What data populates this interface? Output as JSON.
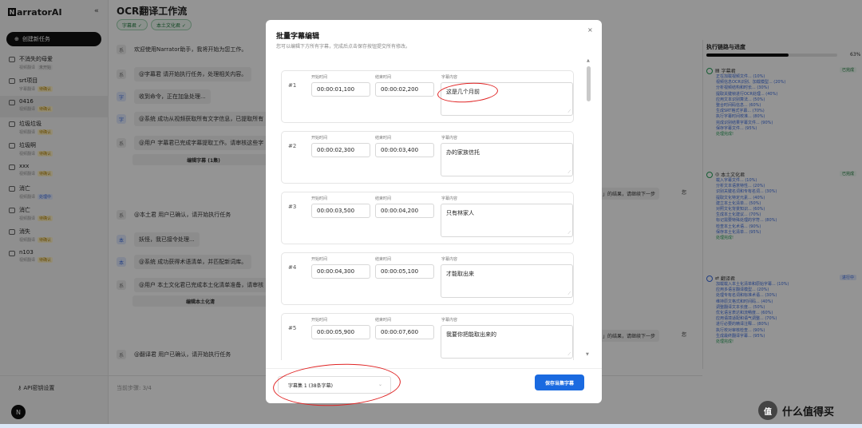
{
  "sidebar": {
    "brand": "NarratorAI",
    "brand_letter": "N",
    "brand_rest": "arratorAI",
    "collapse_glyph": "«",
    "new_task": "创建新任务",
    "tasks": [
      {
        "name": "不消失的母爱",
        "sub": "视频翻译",
        "badge": "未开始"
      },
      {
        "name": "srt项目",
        "sub": "字幕翻译",
        "badge": "待确认"
      },
      {
        "name": "0416",
        "sub": "视频翻译",
        "badge": "待确认"
      },
      {
        "name": "垃圾垃圾",
        "sub": "视频翻译",
        "badge": "待确认"
      },
      {
        "name": "垃圾啊",
        "sub": "视频翻译",
        "badge": "待确认"
      },
      {
        "name": "xxx",
        "sub": "视频翻译",
        "badge": "待确认"
      },
      {
        "name": "消亡",
        "sub": "视频翻译",
        "badge": "处理中"
      },
      {
        "name": "消亡",
        "sub": "视频翻译",
        "badge": "待确认"
      },
      {
        "name": "消失",
        "sub": "视频翻译",
        "badge": "待确认"
      },
      {
        "name": "n103",
        "sub": "视频翻译",
        "badge": "待确认"
      }
    ],
    "api": "API密钥设置",
    "avatar": "N"
  },
  "main": {
    "title": "OCR翻译工作流",
    "chips": [
      "字幕君 ✓",
      "本土文化君 ✓"
    ],
    "messages": [
      {
        "icon": "系",
        "text": "欢迎使用Narrator助手，我将开始为您工作。"
      },
      {
        "icon": "系",
        "text": "@字幕君 请开始执行任务，处理相关内容。"
      },
      {
        "icon": "字",
        "text": "收到命令，正在加急处理..."
      },
      {
        "icon": "字",
        "text": "@系统 成功从视频获取所有文字信息，已提取所有"
      },
      {
        "icon": "系",
        "text": "@用户 字幕君已完成字幕提取工作。请审核这些字"
      },
      {
        "icon": "系",
        "text": "@本土君 用户已确认，请开始执行任务"
      },
      {
        "icon": "本",
        "text": "妖怪，我已接令处理..."
      },
      {
        "icon": "本",
        "text": "@系统 成功获得术语清单，并匹配新词库。"
      },
      {
        "icon": "系",
        "text": "@用户 本土文化君已完成本土化清单准备，请审核"
      },
      {
        "icon": "系",
        "text": "@翻译君 用户已确认，请开始执行任务"
      }
    ],
    "edit_sub": "编辑字幕 (1集)",
    "edit_local": "编辑本土化清",
    "right_bubble": "」的结果，请继续下一步",
    "you": "您",
    "step": "当前步骤: 3/4"
  },
  "panel": {
    "title": "执行链路与进度",
    "progress_pct": 63,
    "progress_label": "63%",
    "stages": [
      {
        "name": "字幕君",
        "status": "已完成",
        "subs": [
          "正在加载视频文件... (10%)",
          "视频信息OCR识别、加载模型... (20%)",
          "分析视频结构和时长... (30%)",
          "提取关键帧进行OCR处理... (40%)",
          "应用文本识别算法... (50%)",
          "整合时间码信息... (60%)",
          "生成SRT格式字幕... (70%)",
          "执行字幕时间校准... (80%)",
          "完成识别结果字幕文件... (90%)",
          "保存字幕文件... (95%)",
          "处理完成!"
        ]
      },
      {
        "name": "本土文化君",
        "status": "已完成",
        "subs": [
          "载入字幕文件... (10%)",
          "分析文本语意特性... (20%)",
          "识别关键名词和专有名词... (30%)",
          "提取文化特定元素... (40%)",
          "建立本土化清单... (50%)",
          "对照文化背景知识... (60%)",
          "生成本土化建议... (70%)",
          "标记需要特殊处理的字符... (80%)",
          "检查本土化术语... (90%)",
          "保存本土化清单... (95%)",
          "处理完成!"
        ]
      },
      {
        "name": "翻译君",
        "status": "进行中",
        "subs": [
          "加载载入本土化清单和原始字幕... (10%)",
          "应用多语言翻译模型... (20%)",
          "处理专有名词和标准术语... (30%)",
          "维持原文格式和时间码... (40%)",
          "调整翻译文本长度... (50%)",
          "优化语言表达和流畅度... (60%)",
          "应用语境适配和语气调整... (70%)",
          "进行必要的精译注释... (80%)",
          "执行校对审核检查... (90%)",
          "生成最终翻译字幕... (95%)",
          "处理完成!"
        ]
      }
    ]
  },
  "modal": {
    "title": "批量字幕编辑",
    "subtitle": "您可以编辑下方所有字幕，完成后点击保存按钮提交所有修改。",
    "close": "×",
    "label_start": "开始时间",
    "label_end": "结束时间",
    "label_content": "字幕内容",
    "rows": [
      {
        "num": "#1",
        "start": "00:00:01,100",
        "end": "00:00:02,200",
        "text": "这是几个月前"
      },
      {
        "num": "#2",
        "start": "00:00:02,300",
        "end": "00:00:03,400",
        "text": "办的家族信托"
      },
      {
        "num": "#3",
        "start": "00:00:03,500",
        "end": "00:00:04,200",
        "text": "只有林家人"
      },
      {
        "num": "#4",
        "start": "00:00:04,300",
        "end": "00:00:05,100",
        "text": "才能取出来"
      },
      {
        "num": "#5",
        "start": "00:00:05,900",
        "end": "00:00:07,600",
        "text": "我要你把能取出来的"
      }
    ],
    "select_value": "字幕集 1 (38条字幕)",
    "save": "保存当集字幕"
  },
  "footer_logo": {
    "glyph": "值",
    "text": "什么值得买"
  },
  "colors": {
    "accent": "#1a6ae0",
    "annotation": "#e02424",
    "success": "#27a05a"
  }
}
